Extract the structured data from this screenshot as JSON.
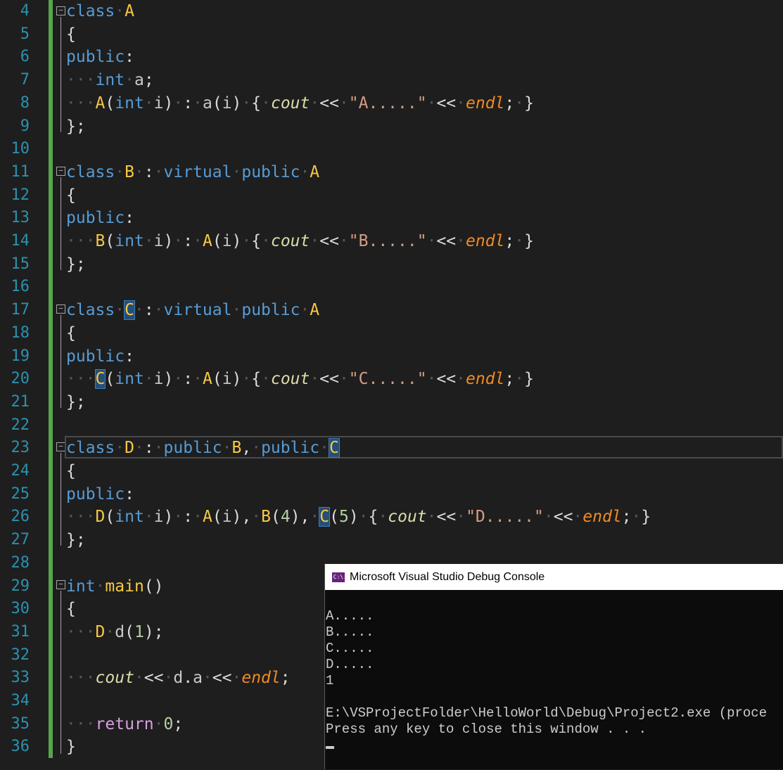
{
  "editor": {
    "line_numbers": [
      "4",
      "5",
      "6",
      "7",
      "8",
      "9",
      "10",
      "11",
      "12",
      "13",
      "14",
      "15",
      "16",
      "17",
      "18",
      "19",
      "20",
      "21",
      "22",
      "23",
      "24",
      "25",
      "26",
      "27",
      "28",
      "29",
      "30",
      "31",
      "32",
      "33",
      "34",
      "35",
      "36"
    ]
  },
  "console": {
    "title": "Microsoft Visual Studio Debug Console",
    "icon_label": "C:\\",
    "lines": [
      "A.....",
      "B.....",
      "C.....",
      "D.....",
      "1",
      "",
      "E:\\VSProjectFolder\\HelloWorld\\Debug\\Project2.exe (proce",
      "Press any key to close this window . . ."
    ]
  },
  "colors": {
    "background": "#1e1e1e",
    "keyword": "#569cd6",
    "class_name": "#f7c843",
    "string": "#d69d85",
    "line_number": "#2b91af",
    "gutter_change": "#57a64a"
  }
}
